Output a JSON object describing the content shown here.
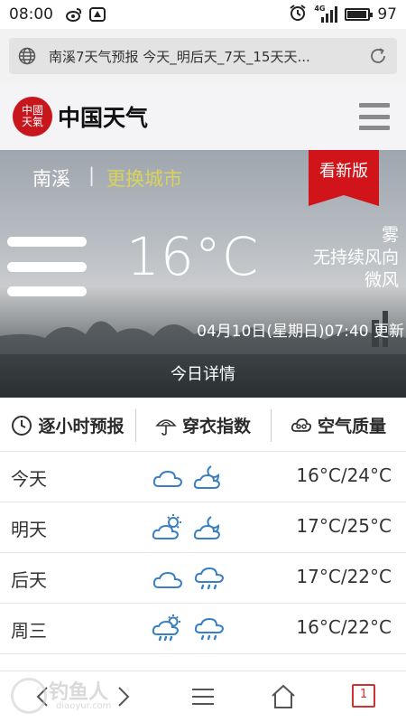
{
  "status_bar": {
    "time": "08:00",
    "signal": "4G",
    "battery": "97",
    "battery_level_percent": 97,
    "icons": [
      "weibo-icon",
      "notification-icon",
      "alarm-icon",
      "signal-icon",
      "battery-icon"
    ]
  },
  "browser": {
    "url_title": "南溪7天气预报 今天_明后天_7天_15天天..."
  },
  "site": {
    "seal_text": "中國天氣",
    "name": "中国天气"
  },
  "hero": {
    "city": "南溪",
    "separator": "|",
    "change_city": "更换城市",
    "new_version": "看新版",
    "temperature": "16°C",
    "weather": "雾",
    "wind_direction": "无持续风向",
    "wind_level": "微风",
    "updated": "04月10日(星期日)07:40 更新",
    "today_detail": "今日详情"
  },
  "tabs": [
    {
      "label": "逐小时预报",
      "icon": "clock-icon"
    },
    {
      "label": "穿衣指数",
      "icon": "umbrella-icon"
    },
    {
      "label": "空气质量",
      "icon": "cloud-air-icon"
    }
  ],
  "forecast": [
    {
      "day": "今天",
      "day_icon": "cloudy-icon",
      "night_icon": "partly-cloudy-night-icon",
      "range": "16°C/24°C"
    },
    {
      "day": "明天",
      "day_icon": "partly-cloudy-day-icon",
      "night_icon": "partly-cloudy-night-icon",
      "range": "17°C/25°C"
    },
    {
      "day": "后天",
      "day_icon": "cloudy-icon",
      "night_icon": "rain-icon",
      "range": "17°C/22°C"
    },
    {
      "day": "周三",
      "day_icon": "sun-rain-icon",
      "night_icon": "rain-icon",
      "range": "16°C/22°C"
    }
  ],
  "bottom_nav": {
    "tab_count": "1",
    "watermark_text": "钓鱼人",
    "watermark_url": "diaoyur.com"
  },
  "colors": {
    "brand_red": "#c8161d",
    "change_city": "#d9d35a",
    "icon_blue": "#3a7fc1"
  }
}
